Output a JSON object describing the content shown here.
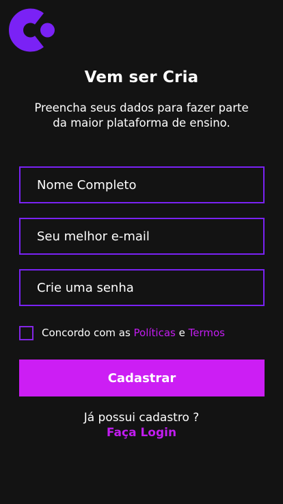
{
  "brand": {
    "logo_icon": "cria-logo-icon",
    "accent_color": "#7a22f5",
    "highlight_color": "#cc1ef4"
  },
  "header": {
    "title": "Vem ser Cria",
    "subtitle": "Preencha seus dados para fazer parte\nda maior plataforma de ensino."
  },
  "form": {
    "name_placeholder": "Nome Completo",
    "email_placeholder": "Seu melhor e-mail",
    "password_placeholder": "Crie uma senha",
    "agree_prefix": "Concordo com as ",
    "policies_link": "Políticas",
    "agree_conjunction": " e ",
    "terms_link": "Termos",
    "submit_label": "Cadastrar"
  },
  "footer": {
    "already_text": "Já possui cadastro ?",
    "login_link": "Faça Login"
  }
}
